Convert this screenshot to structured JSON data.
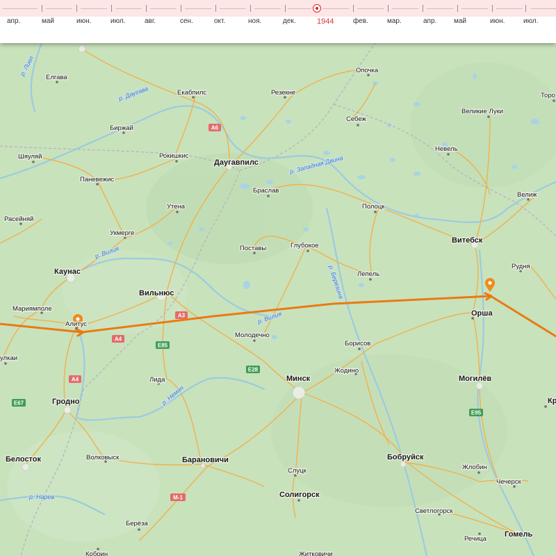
{
  "timeline": {
    "months": [
      "апр.",
      "май",
      "июн.",
      "июл.",
      "авг.",
      "сен.",
      "окт.",
      "ноя.",
      "дек.",
      "1944",
      "фев.",
      "мар.",
      "апр.",
      "май",
      "июн.",
      "июл."
    ],
    "current_label": "1944",
    "colors": {
      "bar": "#fde6e6",
      "marker": "#dd2222",
      "current_text": "#e0343a"
    }
  },
  "map": {
    "cities": {
      "elgava": "Елгава",
      "birzhai": "Биржай",
      "ekabpils": "Екабпилс",
      "rezekne": "Резекне",
      "opochka": "Опочка",
      "velikie_luki": "Великие Луки",
      "sebezh": "Себеж",
      "nevel": "Невель",
      "shyaulyai": "Шяуляй",
      "rokishkis": "Рокишкис",
      "daugavpils": "Даугавпилс",
      "panevezhis": "Паневежис",
      "braslav": "Браслав",
      "utena": "Утена",
      "polotsk": "Полоцк",
      "velizh": "Велиж",
      "raseiniai": "Расейняй",
      "ukmerge": "Укмерге",
      "postavy": "Поставы",
      "glubokoe": "Глубокое",
      "vitebsk": "Витебск",
      "kaunas": "Каунас",
      "rudnya": "Рудня",
      "lepel": "Лепель",
      "vilnius": "Вильнюс",
      "mariampole": "Мариямполе",
      "alytus": "Алитус",
      "orsha": "Орша",
      "molodechno": "Молодечно",
      "borisov": "Борисов",
      "zhodino": "Жодино",
      "vulkai": "улкаи",
      "minsk": "Минск",
      "mogilev": "Могилёв",
      "lida": "Лида",
      "grodno": "Гродно",
      "krichev": "Кр",
      "bialystok": "Белосток",
      "volkovysk": "Волковыск",
      "baranovichi": "Барановичи",
      "bobruisk": "Бобруйск",
      "chechersk": "Чечерск",
      "slutsk": "Слуцк",
      "zhlobin": "Жлобин",
      "soligorsk": "Солигорск",
      "svetlogorsk": "Светлогорск",
      "bereza": "Берёза",
      "rechitsa": "Речица",
      "gomel": "Гомель",
      "kobrin": "Кобрин",
      "zhitkovichi": "Житковичи",
      "toro": "Торо"
    },
    "rivers": {
      "daugava": "р. Даугава",
      "zapadnaya_dvina": "р. Западная Двина",
      "viliya_west": "р. Вилия",
      "viliya_east": "р. Вилия",
      "berezina": "р. Березина",
      "neman": "р. Неман",
      "narev": "р. Нарев",
      "lieluppe": "р. Лиел"
    },
    "roads": {
      "a6": "A6",
      "a3": "A3",
      "a4_north": "A4",
      "a4_south": "A4",
      "e85": "E85",
      "e28": "E28",
      "e67": "E67",
      "e95": "E95",
      "m1": "M-1"
    },
    "colors": {
      "land": "#c8e2bc",
      "water": "#a8d3e6",
      "road": "#f2b04a",
      "route": "#ea7a12",
      "shield_a": "#e46a6a",
      "shield_e": "#3f9c58"
    }
  }
}
